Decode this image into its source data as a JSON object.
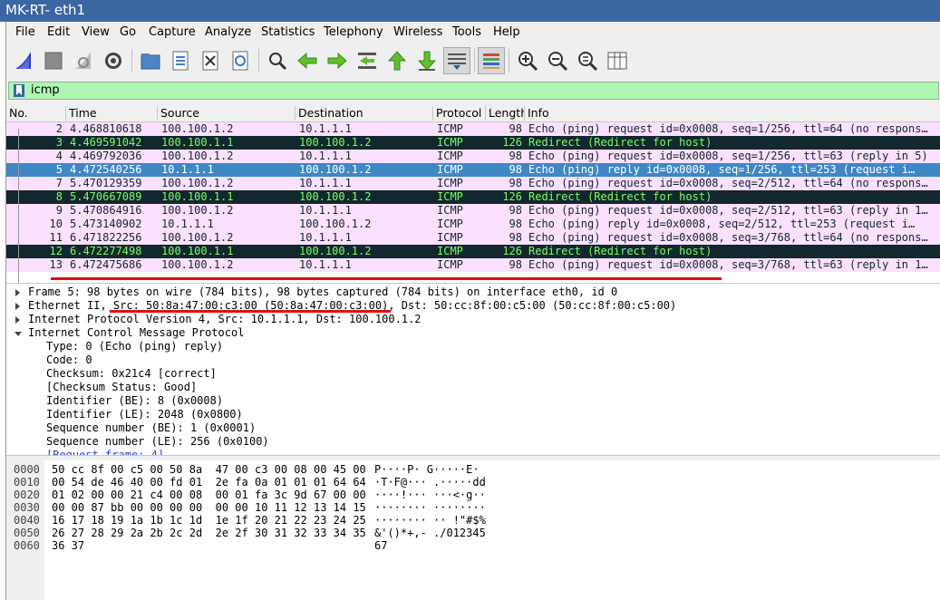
{
  "window": {
    "title": "MK-RT- eth1"
  },
  "menu": [
    "File",
    "Edit",
    "View",
    "Go",
    "Capture",
    "Analyze",
    "Statistics",
    "Telephony",
    "Wireless",
    "Tools",
    "Help"
  ],
  "toolbar": {
    "icons": [
      "shark-fin-start-icon",
      "stop-square-icon",
      "restart-fin-icon",
      "capture-options-gear-icon",
      "open-folder-icon",
      "save-file-icon",
      "close-file-icon",
      "reload-icon",
      "find-magnifier-icon",
      "go-back-arrow-icon",
      "go-forward-arrow-icon",
      "go-to-packet-icon",
      "go-first-packet-icon",
      "go-last-packet-icon",
      "autoscroll-icon",
      "colorize-icon",
      "zoom-in-icon",
      "zoom-out-icon",
      "zoom-normal-icon",
      "resize-columns-icon"
    ]
  },
  "filter": {
    "value": "icmp"
  },
  "columns": [
    "No.",
    "Time",
    "Source",
    "Destination",
    "Protocol",
    "Length",
    "Info"
  ],
  "packets": [
    {
      "no": "2",
      "time": "4.468810618",
      "src": "100.100.1.2",
      "dst": "10.1.1.1",
      "proto": "ICMP",
      "len": "98",
      "info": "Echo (ping) request  id=0x0008, seq=1/256, ttl=64 (no respons…",
      "kind": "icmp"
    },
    {
      "no": "3",
      "time": "4.469591042",
      "src": "100.100.1.1",
      "dst": "100.100.1.2",
      "proto": "ICMP",
      "len": "126",
      "info": "Redirect             (Redirect for host)",
      "kind": "redir"
    },
    {
      "no": "4",
      "time": "4.469792036",
      "src": "100.100.1.2",
      "dst": "10.1.1.1",
      "proto": "ICMP",
      "len": "98",
      "info": "Echo (ping) request  id=0x0008, seq=1/256, ttl=63 (reply in 5)",
      "kind": "icmp"
    },
    {
      "no": "5",
      "time": "4.472540256",
      "src": "10.1.1.1",
      "dst": "100.100.1.2",
      "proto": "ICMP",
      "len": "98",
      "info": "Echo (ping) reply    id=0x0008, seq=1/256, ttl=253 (request i…",
      "kind": "sel"
    },
    {
      "no": "7",
      "time": "5.470129359",
      "src": "100.100.1.2",
      "dst": "10.1.1.1",
      "proto": "ICMP",
      "len": "98",
      "info": "Echo (ping) request  id=0x0008, seq=2/512, ttl=64 (no respons…",
      "kind": "icmp"
    },
    {
      "no": "8",
      "time": "5.470667089",
      "src": "100.100.1.1",
      "dst": "100.100.1.2",
      "proto": "ICMP",
      "len": "126",
      "info": "Redirect             (Redirect for host)",
      "kind": "redir"
    },
    {
      "no": "9",
      "time": "5.470864916",
      "src": "100.100.1.2",
      "dst": "10.1.1.1",
      "proto": "ICMP",
      "len": "98",
      "info": "Echo (ping) request  id=0x0008, seq=2/512, ttl=63 (reply in 1…",
      "kind": "icmp"
    },
    {
      "no": "10",
      "time": "5.473140902",
      "src": "10.1.1.1",
      "dst": "100.100.1.2",
      "proto": "ICMP",
      "len": "98",
      "info": "Echo (ping) reply    id=0x0008, seq=2/512, ttl=253 (request i…",
      "kind": "icmp"
    },
    {
      "no": "11",
      "time": "6.471822256",
      "src": "100.100.1.2",
      "dst": "10.1.1.1",
      "proto": "ICMP",
      "len": "98",
      "info": "Echo (ping) request  id=0x0008, seq=3/768, ttl=64 (no respons…",
      "kind": "icmp"
    },
    {
      "no": "12",
      "time": "6.472277498",
      "src": "100.100.1.1",
      "dst": "100.100.1.2",
      "proto": "ICMP",
      "len": "126",
      "info": "Redirect             (Redirect for host)",
      "kind": "redir"
    },
    {
      "no": "13",
      "time": "6.472475686",
      "src": "100.100.1.2",
      "dst": "10.1.1.1",
      "proto": "ICMP",
      "len": "98",
      "info": "Echo (ping) request  id=0x0008, seq=3/768, ttl=63 (reply in 1…",
      "kind": "icmp"
    }
  ],
  "details": {
    "frame": "Frame 5: 98 bytes on wire (784 bits), 98 bytes captured (784 bits) on interface eth0, id 0",
    "ethernet": "Ethernet II, Src: 50:8a:47:00:c3:00 (50:8a:47:00:c3:00), Dst: 50:cc:8f:00:c5:00 (50:cc:8f:00:c5:00)",
    "ip": "Internet Protocol Version 4, Src: 10.1.1.1, Dst: 100.100.1.2",
    "icmp": "Internet Control Message Protocol",
    "icmp_fields": [
      "Type: 0 (Echo (ping) reply)",
      "Code: 0",
      "Checksum: 0x21c4 [correct]",
      "[Checksum Status: Good]",
      "Identifier (BE): 8 (0x0008)",
      "Identifier (LE): 2048 (0x0800)",
      "Sequence number (BE): 1 (0x0001)",
      "Sequence number (LE): 256 (0x0100)"
    ],
    "request_link": "[Request frame: 4]"
  },
  "hex": [
    {
      "off": "0000",
      "bytes": "50 cc 8f 00 c5 00 50 8a  47 00 c3 00 08 00 45 00",
      "ascii": "P····P· G·····E·"
    },
    {
      "off": "0010",
      "bytes": "00 54 de 46 40 00 fd 01  2e fa 0a 01 01 01 64 64",
      "ascii": "·T·F@··· .·····dd"
    },
    {
      "off": "0020",
      "bytes": "01 02 00 00 21 c4 00 08  00 01 fa 3c 9d 67 00 00",
      "ascii": "····!··· ···<·g··"
    },
    {
      "off": "0030",
      "bytes": "00 00 87 bb 00 00 00 00  00 00 10 11 12 13 14 15",
      "ascii": "········ ········"
    },
    {
      "off": "0040",
      "bytes": "16 17 18 19 1a 1b 1c 1d  1e 1f 20 21 22 23 24 25",
      "ascii": "········ ·· !\"#$%"
    },
    {
      "off": "0050",
      "bytes": "26 27 28 29 2a 2b 2c 2d  2e 2f 30 31 32 33 34 35",
      "ascii": "&'()*+,- ./012345"
    },
    {
      "off": "0060",
      "bytes": "36 37",
      "ascii": "67"
    }
  ]
}
